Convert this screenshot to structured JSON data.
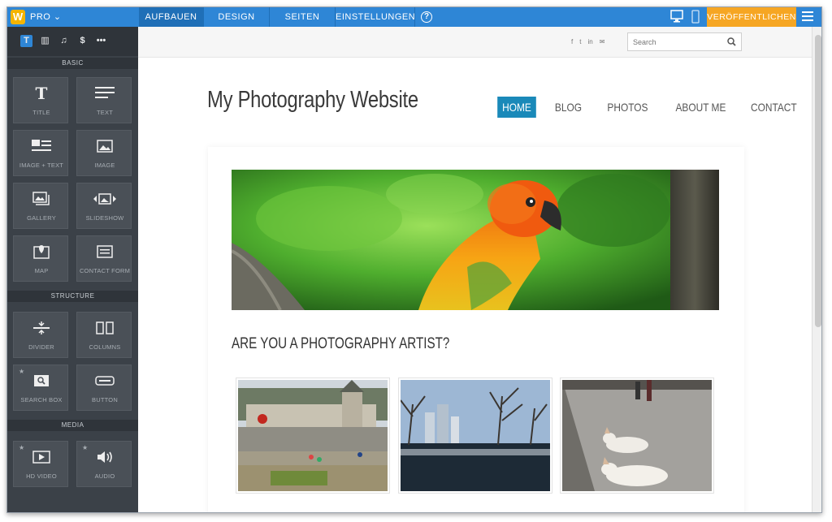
{
  "topbar": {
    "logo_letter": "W",
    "plan_label": "PRO ⌄",
    "tabs": [
      "AUFBAUEN",
      "DESIGN",
      "SEITEN",
      "EINSTELLUNGEN"
    ],
    "help": "?",
    "publish_label": "VERÖFFENTLICHEN"
  },
  "sidebar": {
    "tools": [
      "T",
      "▥",
      "♫",
      "$",
      "•••"
    ],
    "sections": {
      "basic": "BASIC",
      "structure": "STRUCTURE",
      "media": "MEDIA"
    },
    "tiles": {
      "title": "TITLE",
      "text": "TEXT",
      "image_text": "IMAGE + TEXT",
      "image": "IMAGE",
      "gallery": "GALLERY",
      "slideshow": "SLIDESHOW",
      "map": "MAP",
      "contact_form": "CONTACT FORM",
      "divider": "DIVIDER",
      "columns": "COLUMNS",
      "search_box": "SEARCH BOX",
      "button": "BUTTON",
      "hd_video": "HD VIDEO",
      "audio": "AUDIO"
    }
  },
  "site": {
    "social": [
      "f",
      "t",
      "in",
      "✉"
    ],
    "search_placeholder": "Search",
    "title": "My Photography Website",
    "nav": [
      "HOME",
      "BLOG",
      "PHOTOS",
      "ABOUT ME",
      "CONTACT"
    ],
    "headline": "ARE YOU A PHOTOGRAPHY ARTIST?"
  },
  "colors": {
    "accent": "#2e86d6",
    "publish": "#f6a623",
    "nav_active": "#1a89b9"
  }
}
